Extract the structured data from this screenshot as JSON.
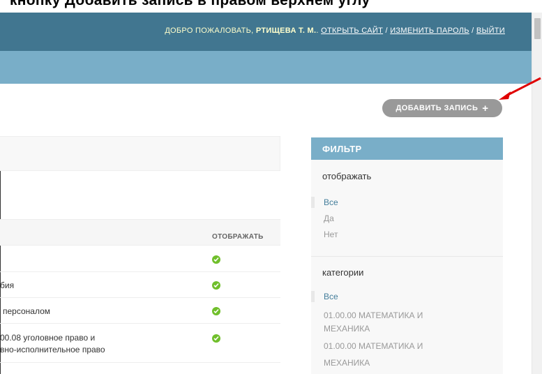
{
  "top_caption": "кнопку Добавить запись в правом верхнем углу",
  "header": {
    "welcome": "ДОБРО ПОЖАЛОВАТЬ,",
    "user": "РТИЩЕВА Т. М.",
    "dot": ".",
    "view_site": "ОТКРЫТЬ САЙТ",
    "sep1": " / ",
    "change_password": "ИЗМЕНИТЬ ПАРОЛЬ",
    "sep2": " / ",
    "logout": "ВЫЙТИ"
  },
  "add_button": {
    "label": "ДОБАВИТЬ ЗАПИСЬ",
    "icon": "plus-icon"
  },
  "table": {
    "column_display": "ОТОБРАЖАТЬ",
    "rows": [
      {
        "text": "",
        "display": true
      },
      {
        "text": "бия",
        "display": true
      },
      {
        "text": "персоналом",
        "display": true
      },
      {
        "text_line1": "00.08 уголовное право и",
        "text_line2": "вно-исполнительное право",
        "display": true
      }
    ]
  },
  "filter": {
    "title": "ФИЛЬТР",
    "groups": [
      {
        "heading": "отображать",
        "options": [
          "Все",
          "Да",
          "Нет"
        ],
        "selected": "Все"
      },
      {
        "heading": "категории",
        "options": [
          "Все",
          "01.00.00 МАТЕМАТИКА И",
          "МЕХАНИКА",
          "01.00.00 МАТЕМАТИКА И",
          "МЕХАНИКА"
        ],
        "selected": "Все"
      }
    ]
  },
  "colors": {
    "header": "#417690",
    "breadcrumbs": "#79aec8",
    "filter_title": "#79aec8",
    "check": "#70bf2b",
    "link": "#447e9b",
    "arrow": "#e00000"
  }
}
